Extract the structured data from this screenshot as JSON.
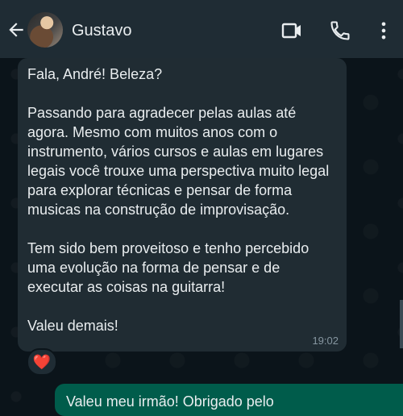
{
  "header": {
    "contact_name": "Gustavo",
    "icons": {
      "back": "arrow-left-icon",
      "video": "video-call-icon",
      "phone": "voice-call-icon",
      "more": "more-vertical-icon"
    }
  },
  "messages": {
    "incoming": {
      "paragraphs": [
        "Fala, André! Beleza?",
        "Passando para agradecer pelas aulas até agora. Mesmo com muitos anos com o instrumento, vários cursos e aulas em lugares legais você trouxe uma perspectiva muito legal para explorar técnicas e pensar de forma musicas na construção de improvisação.",
        "Tem sido bem proveitoso e tenho percebido uma evolução na forma de pensar e de executar as coisas na guitarra!",
        "Valeu demais!"
      ],
      "time": "19:02",
      "reaction": "❤️"
    },
    "outgoing": {
      "text": "Valeu meu irmão! Obrigado pelo"
    }
  },
  "colors": {
    "header_bg": "#1f2c34",
    "chat_bg": "#0b141a",
    "incoming_bubble": "#202c33",
    "outgoing_bubble": "#005c4b",
    "text": "#e9edef",
    "meta": "#8696a0"
  }
}
